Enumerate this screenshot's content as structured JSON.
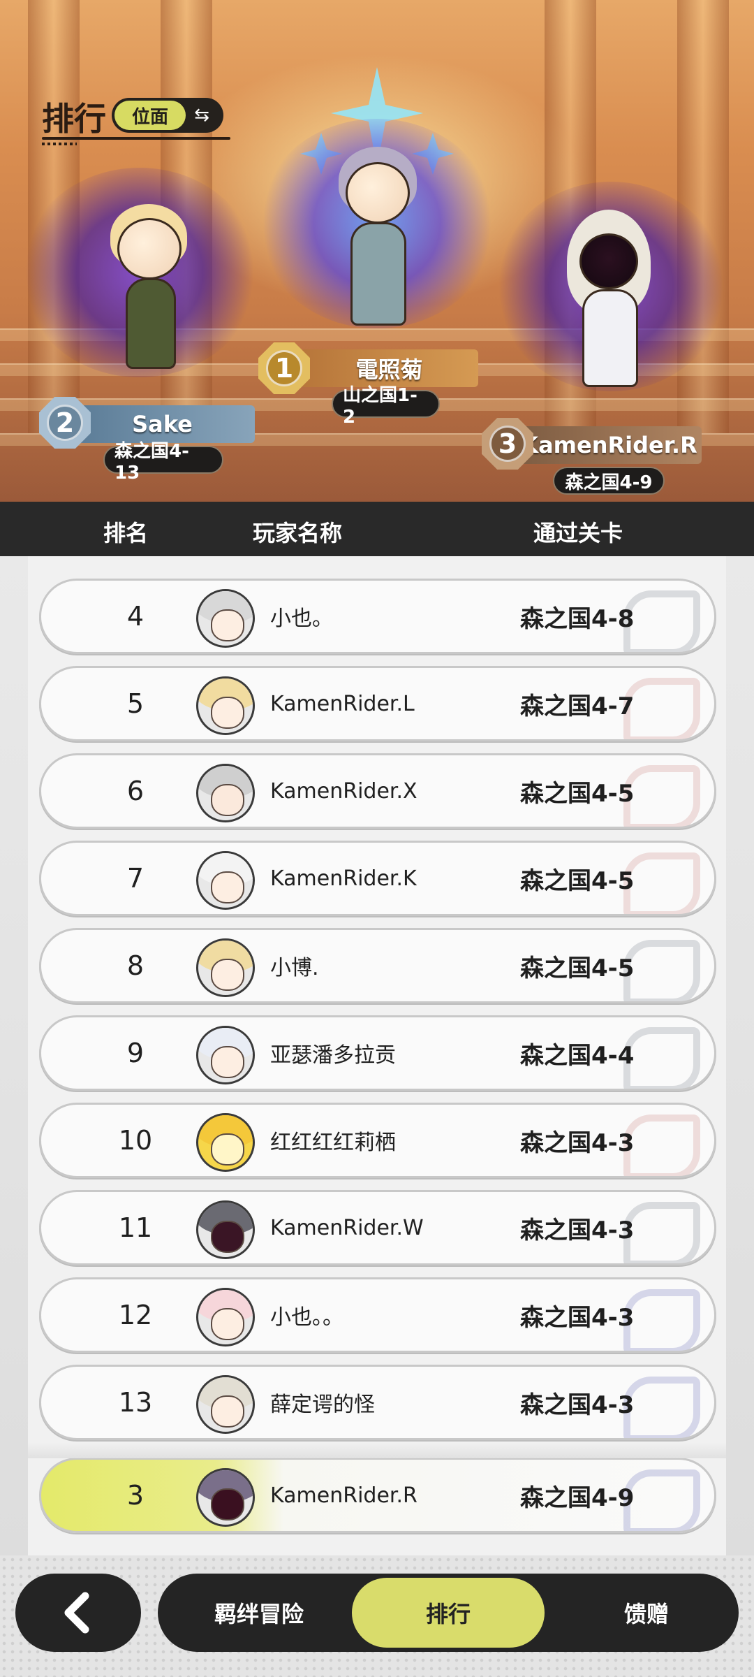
{
  "header": {
    "title": "排行",
    "mode_label": "位面",
    "swap_icon": "⇆"
  },
  "podium": {
    "first": {
      "rank": "1",
      "name": "電照菊",
      "stage": "山之国1-2"
    },
    "second": {
      "rank": "2",
      "name": "Sake",
      "stage": "森之国4-13"
    },
    "third": {
      "rank": "3",
      "name": "KamenRider.R",
      "stage": "森之国4-9"
    }
  },
  "table": {
    "col_rank": "排名",
    "col_name": "玩家名称",
    "col_stage": "通过关卡"
  },
  "rows": [
    {
      "rank": "4",
      "name": "小也。",
      "stage": "森之国4-8"
    },
    {
      "rank": "5",
      "name": "KamenRider.L",
      "stage": "森之国4-7"
    },
    {
      "rank": "6",
      "name": "KamenRider.X",
      "stage": "森之国4-5"
    },
    {
      "rank": "7",
      "name": "KamenRider.K",
      "stage": "森之国4-5"
    },
    {
      "rank": "8",
      "name": "小博.",
      "stage": "森之国4-5"
    },
    {
      "rank": "9",
      "name": "亚瑟潘多拉贡",
      "stage": "森之国4-4"
    },
    {
      "rank": "10",
      "name": "红红红红莉栖",
      "stage": "森之国4-3"
    },
    {
      "rank": "11",
      "name": "KamenRider.W",
      "stage": "森之国4-3"
    },
    {
      "rank": "12",
      "name": "小也。。",
      "stage": "森之国4-3"
    },
    {
      "rank": "13",
      "name": "薛定谔的怪",
      "stage": "森之国4-3"
    }
  ],
  "self_row": {
    "rank": "3",
    "name": "KamenRider.R",
    "stage": "森之国4-9"
  },
  "nav": {
    "back_icon": "back-chevron-icon",
    "tabs": [
      {
        "label": "羁绊冒险"
      },
      {
        "label": "排行"
      },
      {
        "label": "馈赠"
      }
    ]
  },
  "colors": {
    "accent": "#d9dc6b",
    "dark": "#242424",
    "gold_medal": "#c9a04a",
    "silver_medal": "#7a95ab",
    "bronze_medal": "#8a6a4a"
  }
}
